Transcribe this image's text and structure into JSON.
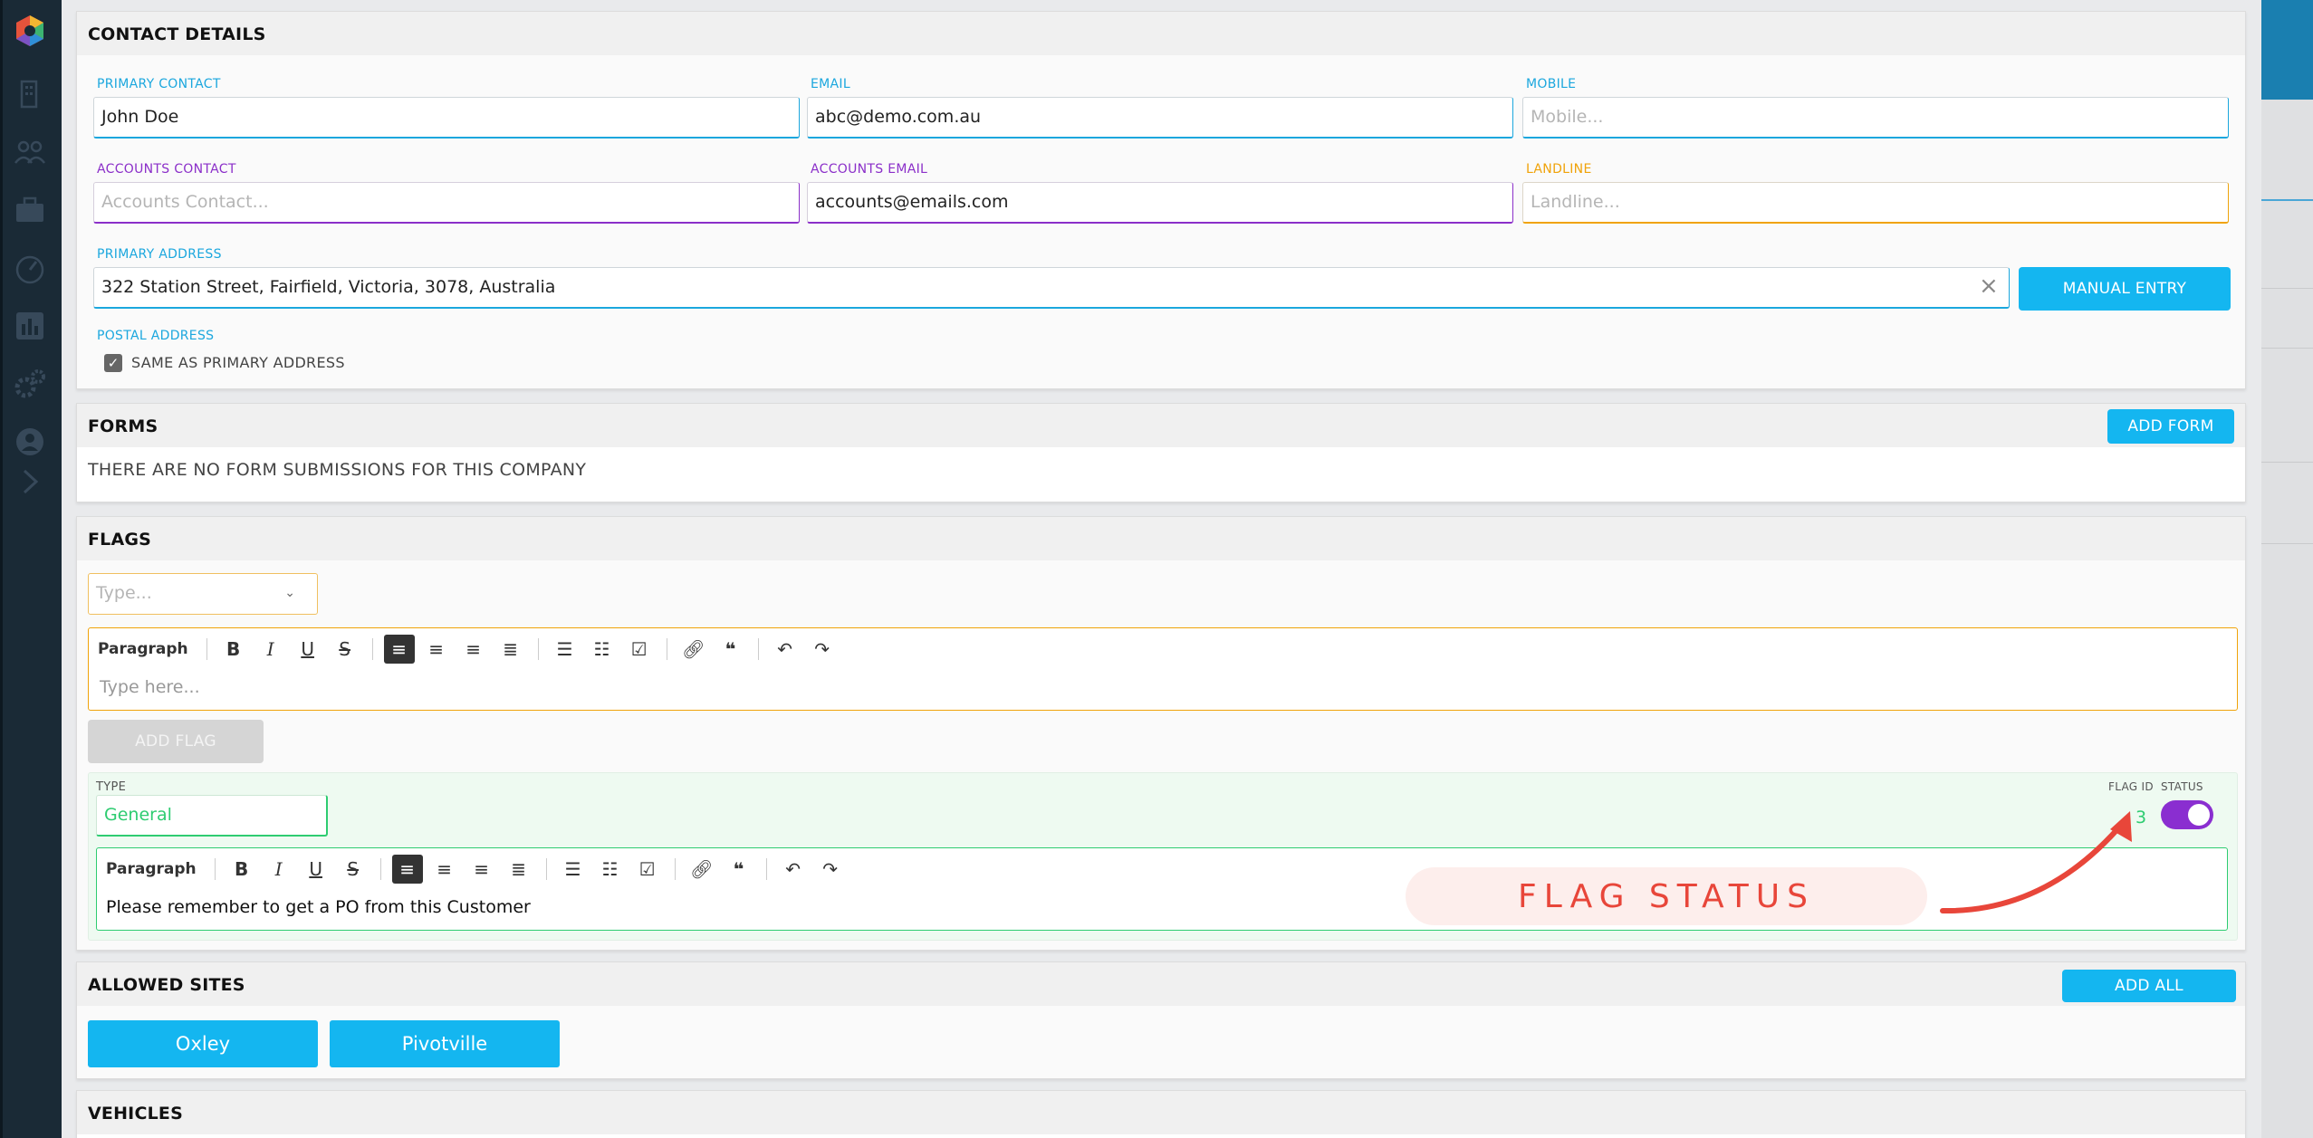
{
  "contact_details": {
    "title": "CONTACT DETAILS",
    "primary_contact": {
      "label": "PRIMARY CONTACT",
      "value": "John Doe"
    },
    "email": {
      "label": "EMAIL",
      "value": "abc@demo.com.au"
    },
    "mobile": {
      "label": "MOBILE",
      "placeholder": "Mobile..."
    },
    "accounts_contact": {
      "label": "ACCOUNTS CONTACT",
      "placeholder": "Accounts Contact..."
    },
    "accounts_email": {
      "label": "ACCOUNTS EMAIL",
      "value": "accounts@emails.com"
    },
    "landline": {
      "label": "LANDLINE",
      "placeholder": "Landline..."
    },
    "primary_address": {
      "label": "PRIMARY ADDRESS",
      "value": "322 Station Street, Fairfield, Victoria, 3078, Australia"
    },
    "manual_entry_label": "MANUAL ENTRY",
    "postal_address": {
      "label": "POSTAL ADDRESS",
      "same_as_label": "SAME AS PRIMARY ADDRESS",
      "checked": true
    }
  },
  "forms": {
    "title": "FORMS",
    "add_label": "ADD FORM",
    "empty_text": "THERE ARE NO FORM SUBMISSIONS FOR THIS COMPANY"
  },
  "flags": {
    "title": "FLAGS",
    "type_placeholder": "Type...",
    "editor_paragraph": "Paragraph",
    "editor_placeholder": "Type here...",
    "add_label": "ADD FLAG",
    "item": {
      "type_label": "TYPE",
      "type_value": "General",
      "flag_id_label": "FLAG ID",
      "flag_id": "3",
      "status_label": "STATUS",
      "status_on": true,
      "paragraph": "Paragraph",
      "text": "Please remember to get a PO from this Customer"
    }
  },
  "annotation": {
    "text": "FLAG STATUS",
    "color": "#e8463a"
  },
  "allowed_sites": {
    "title": "ALLOWED SITES",
    "add_all_label": "ADD ALL",
    "sites": [
      "Oxley",
      "Pivotville"
    ]
  },
  "vehicles": {
    "title": "VEHICLES"
  },
  "colors": {
    "accent": "#14b6f0",
    "purple": "#8b2fc9",
    "orange": "#f0a30a",
    "green": "#2ecc71",
    "sidebar": "#1a2a36"
  }
}
